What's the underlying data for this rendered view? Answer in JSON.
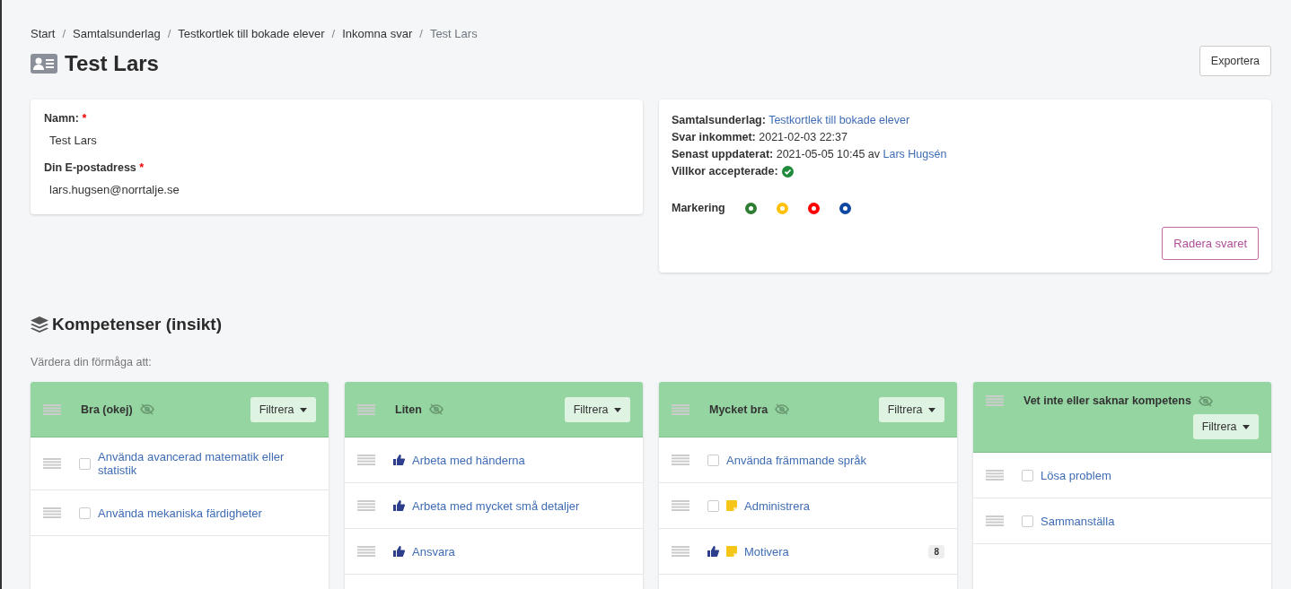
{
  "breadcrumb_separator": "/",
  "breadcrumb": [
    {
      "label": "Start",
      "current": false
    },
    {
      "label": "Samtalsunderlag",
      "current": false
    },
    {
      "label": "Testkortlek till bokade elever",
      "current": false
    },
    {
      "label": "Inkomna svar",
      "current": false
    },
    {
      "label": "Test Lars",
      "current": true
    }
  ],
  "title": "Test Lars",
  "export_button": "Exportera",
  "form": {
    "fields": [
      {
        "label": "Namn:",
        "required_mark": "*",
        "value": "Test Lars"
      },
      {
        "label": "Din E-postadress",
        "required_mark": "*",
        "value": "lars.hugsen@norrtalje.se"
      }
    ]
  },
  "info": {
    "rows": [
      {
        "label": "Samtalsunderlag:",
        "text": "",
        "link": "Testkortlek till bokade elever"
      },
      {
        "label": "Svar inkommet:",
        "text": "2021-02-03 22:37",
        "link": ""
      },
      {
        "label": "Senast uppdaterat:",
        "text": "2021-05-05 10:45 av",
        "link": "Lars Hugsén"
      }
    ],
    "terms_label": "Villkor accepterade:",
    "terms_accepted": true,
    "marking_label": "Markering",
    "markers": [
      {
        "color": "#2e7d32"
      },
      {
        "color": "#ffc107"
      },
      {
        "color": "#ff0000"
      },
      {
        "color": "#0d47a1"
      }
    ],
    "delete_button": "Radera svaret"
  },
  "section": {
    "title": "Kompetenser (insikt)",
    "subtitle": "Värdera din förmåga att:",
    "columns": [
      {
        "title": "Bra (okej)",
        "filter": "Filtrera",
        "items": [
          {
            "kind": "checkbox",
            "checked": false,
            "note": false,
            "label": "Använda avancerad matematik eller statistik"
          },
          {
            "kind": "checkbox",
            "checked": false,
            "note": false,
            "label": "Använda mekaniska färdigheter"
          }
        ]
      },
      {
        "title": "Liten",
        "filter": "Filtrera",
        "items": [
          {
            "kind": "thumb",
            "note": false,
            "label": "Arbeta med händerna"
          },
          {
            "kind": "thumb",
            "note": false,
            "label": "Arbeta med mycket små detaljer"
          },
          {
            "kind": "thumb",
            "note": false,
            "label": "Ansvara"
          }
        ]
      },
      {
        "title": "Mycket bra",
        "filter": "Filtrera",
        "items": [
          {
            "kind": "checkbox",
            "checked": false,
            "note": false,
            "label": "Använda främmande språk"
          },
          {
            "kind": "checkbox",
            "checked": false,
            "note": true,
            "label": "Administrera"
          },
          {
            "kind": "thumb",
            "note": true,
            "label": "Motivera",
            "count": "8"
          }
        ]
      },
      {
        "title": "Vet inte eller saknar kompetens",
        "filter": "Filtrera",
        "items": [
          {
            "kind": "checkbox",
            "checked": false,
            "note": false,
            "label": "Lösa problem"
          },
          {
            "kind": "checkbox",
            "checked": false,
            "note": false,
            "label": "Sammanställa"
          }
        ]
      }
    ]
  }
}
